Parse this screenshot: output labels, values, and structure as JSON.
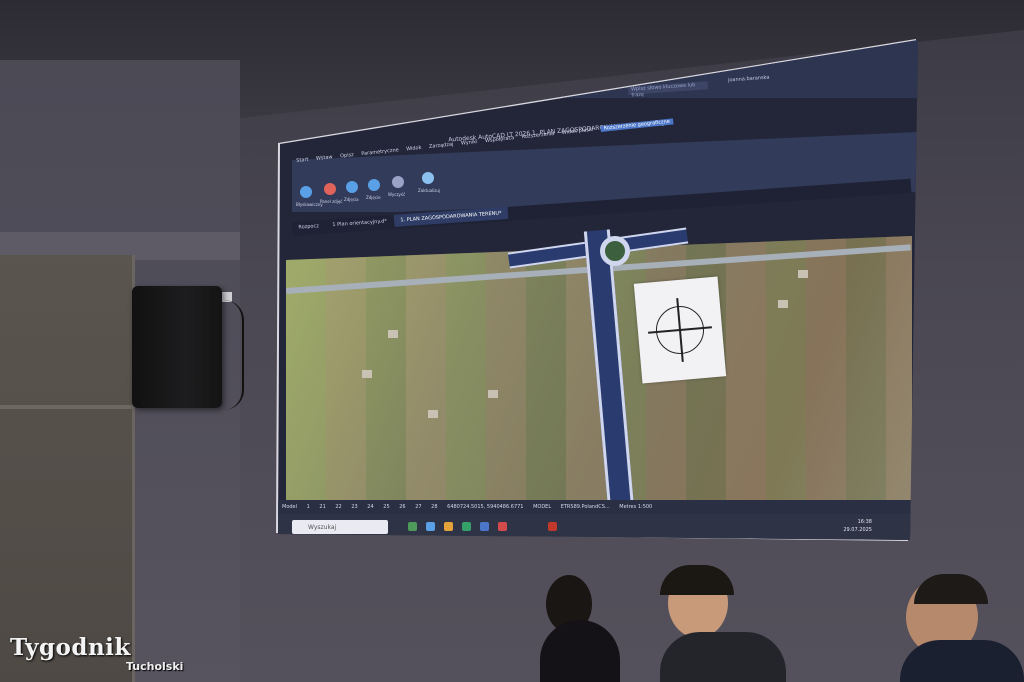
{
  "app": {
    "title": "Autodesk AutoCAD LT 2026  1. PLAN ZAGOSPODAROWANIA TERENU.dwg",
    "search_placeholder": "Wpisz słowo kluczowe lub frazę",
    "user": "joanna.baranska",
    "tabs": [
      "Start",
      "Wstaw",
      "Opisz",
      "Parametryczne",
      "Widok",
      "Zarządzaj",
      "Wyniki",
      "Współpraca",
      "Rozszerzenia",
      "Widok płaski",
      "Rozszerzenie geograficzne"
    ],
    "active_tab": "Rozszerzenie geograficzne",
    "tools": [
      "Błyskawiczny",
      "Panel zdjęć",
      "Zdjęcia",
      "Zdjęcie",
      "Wyczyść",
      "Zaktualizuj"
    ],
    "doc_tabs": [
      "Rozpocz",
      "1 Plan orientacyjny.d*",
      "1. PLAN ZAGOSPODAROWANIA TERENU*"
    ],
    "active_doc_tab": "1. PLAN ZAGOSPODAROWANIA TERENU*",
    "status": {
      "model_tab": "Model",
      "layout_tabs": [
        "1",
        "21",
        "22",
        "23",
        "24",
        "25",
        "26",
        "27",
        "28"
      ],
      "coords": "6480724.5015, 5940486.6771",
      "space": "MODEL",
      "crs": "ETRS89.PolandCS...",
      "units": "Metres 1:500"
    },
    "taskbar": {
      "search": "Wyszukaj",
      "time": "16:38",
      "date": "29.07.2025"
    }
  },
  "watermark": {
    "brand": "Tygodnik",
    "sub": "Tucholski"
  },
  "colors": {
    "accent": "#4b76c9",
    "road": "#2a3b70"
  }
}
